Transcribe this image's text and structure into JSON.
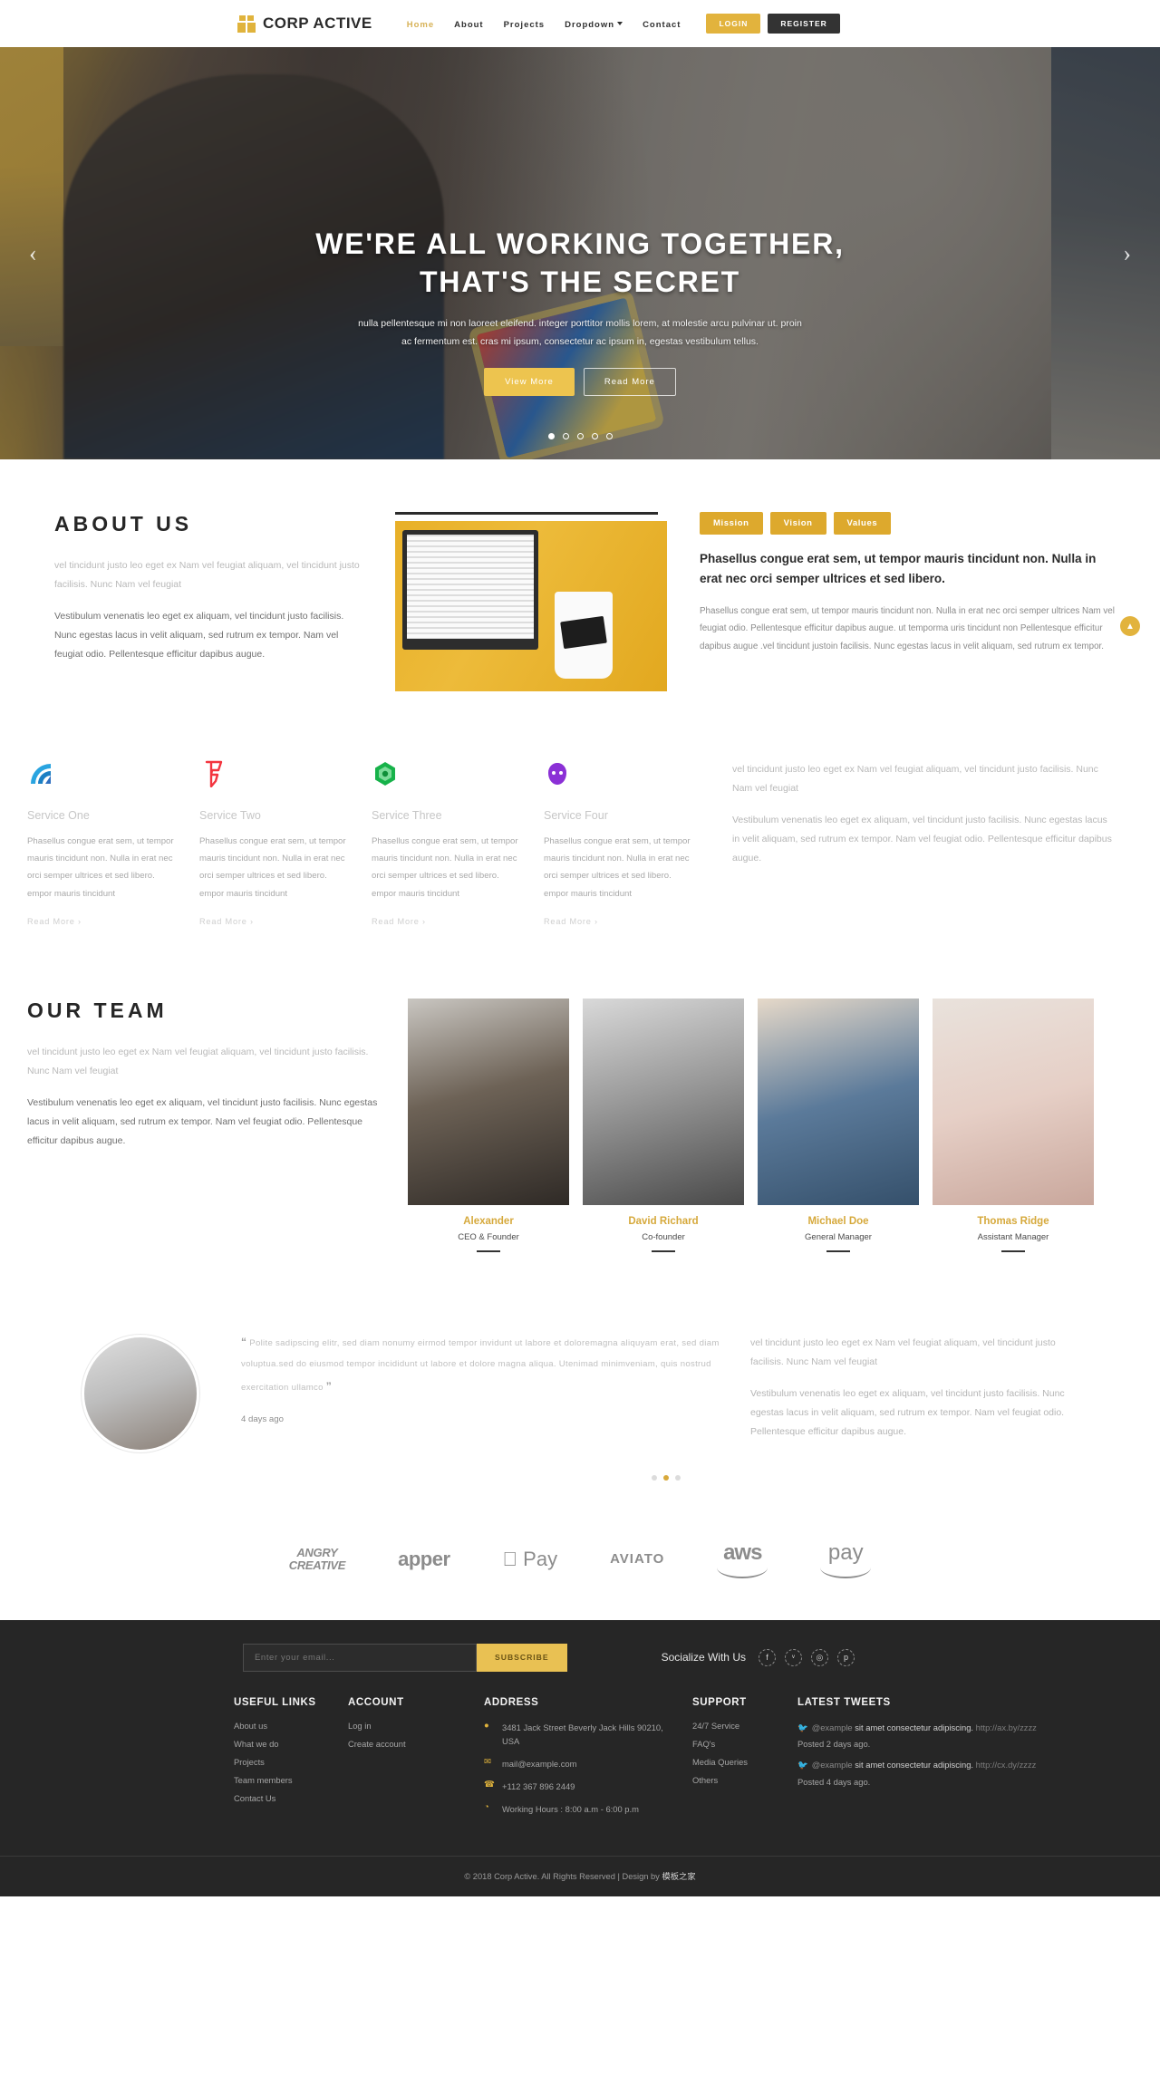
{
  "nav": {
    "brand": "CORP ACTIVE",
    "links": [
      {
        "label": "Home",
        "active": true
      },
      {
        "label": "About",
        "active": false
      },
      {
        "label": "Projects",
        "active": false
      },
      {
        "label": "Dropdown",
        "active": false,
        "caret": true
      },
      {
        "label": "Contact",
        "active": false
      }
    ],
    "login_label": "LOGIN",
    "register_label": "REGISTER",
    "accent": "#e0b33c"
  },
  "hero": {
    "title_line1": "WE'RE ALL WORKING TOGETHER,",
    "title_line2": "THAT'S THE SECRET",
    "subtitle_line1": "nulla pellentesque mi non laoreet eleifend. integer porttitor mollis lorem, at molestie arcu pulvinar ut. proin",
    "subtitle_line2": "ac fermentum est. cras mi ipsum, consectetur ac ipsum in, egestas vestibulum tellus.",
    "btn_primary": "View More",
    "btn_secondary": "Read More",
    "arrow_left": "‹",
    "arrow_right": "›",
    "slide_count": 5,
    "active_slide": 1
  },
  "about": {
    "title": "ABOUT US",
    "muted_paragraph": "vel tincidunt justo leo eget ex Nam vel feugiat aliquam, vel tincidunt justo facilisis. Nunc Nam vel feugiat",
    "paragraph": "Vestibulum venenatis leo eget ex aliquam, vel tincidunt justo facilisis. Nunc egestas lacus in velit aliquam, sed rutrum ex tempor. Nam vel feugiat odio. Pellentesque efficitur dapibus augue.",
    "tabs": [
      {
        "label": "Mission"
      },
      {
        "label": "Vision"
      },
      {
        "label": "Values"
      }
    ],
    "lead": "Phasellus congue erat sem, ut tempor mauris tincidunt non. Nulla in erat nec orci semper ultrices et sed libero.",
    "tab_body": "Phasellus congue erat sem, ut tempor mauris tincidunt non. Nulla in erat nec orci semper ultrices Nam vel feugiat odio. Pellentesque efficitur dapibus augue. ut temporma uris tincidunt non Pellentesque efficitur dapibus augue .vel tincidunt justoin facilisis. Nunc egestas lacus in velit aliquam, sed rutrum ex tempor."
  },
  "scroll_top_icon": "▲",
  "services": {
    "items": [
      {
        "icon": "wifi-waves-icon",
        "name": "Service One",
        "text": "Phasellus congue erat sem, ut tempor mauris tincidunt non. Nulla in erat nec orci semper ultrices et sed libero. empor mauris tincidunt",
        "more": "Read More ›"
      },
      {
        "icon": "foursquare-flag-icon",
        "name": "Service Two",
        "text": "Phasellus congue erat sem, ut tempor mauris tincidunt non. Nulla in erat nec orci semper ultrices et sed libero. empor mauris tincidunt",
        "more": "Read More ›"
      },
      {
        "icon": "green-hexagon-icon",
        "name": "Service Three",
        "text": "Phasellus congue erat sem, ut tempor mauris tincidunt non. Nulla in erat nec orci semper ultrices et sed libero. empor mauris tincidunt",
        "more": "Read More ›"
      },
      {
        "icon": "purple-blob-icon",
        "name": "Service Four",
        "text": "Phasellus congue erat sem, ut tempor mauris tincidunt non. Nulla in erat nec orci semper ultrices et sed libero. empor mauris tincidunt",
        "more": "Read More ›"
      }
    ],
    "aside_muted": "vel tincidunt justo leo eget ex Nam vel feugiat aliquam, vel tincidunt justo facilisis. Nunc Nam vel feugiat",
    "aside_text": "Vestibulum venenatis leo eget ex aliquam, vel tincidunt justo facilisis. Nunc egestas lacus in velit aliquam, sed rutrum ex tempor. Nam vel feugiat odio. Pellentesque efficitur dapibus augue."
  },
  "team": {
    "title": "OUR TEAM",
    "muted_paragraph": "vel tincidunt justo leo eget ex Nam vel feugiat aliquam, vel tincidunt justo facilisis. Nunc Nam vel feugiat",
    "paragraph": "Vestibulum venenatis leo eget ex aliquam, vel tincidunt justo facilisis. Nunc egestas lacus in velit aliquam, sed rutrum ex tempor. Nam vel feugiat odio. Pellentesque efficitur dapibus augue.",
    "members": [
      {
        "name": "Alexander",
        "role": "CEO & Founder"
      },
      {
        "name": "David Richard",
        "role": "Co-founder"
      },
      {
        "name": "Michael Doe",
        "role": "General Manager"
      },
      {
        "name": "Thomas Ridge",
        "role": "Assistant Manager"
      }
    ]
  },
  "testimonial": {
    "quote_open": "“",
    "quote_close": "”",
    "quote": "Polite sadipscing elitr, sed diam nonumy eirmod tempor invidunt ut labore et doloremagna aliquyam erat, sed diam voluptua.sed do eiusmod tempor incididunt ut labore et dolore magna aliqua. Utenimad minimveniam, quis nostrud exercitation ullamco",
    "ago": "4 days ago",
    "aside_muted": "vel tincidunt justo leo eget ex Nam vel feugiat aliquam, vel tincidunt justo facilisis. Nunc Nam vel feugiat",
    "aside_text": "Vestibulum venenatis leo eget ex aliquam, vel tincidunt justo facilisis. Nunc egestas lacus in velit aliquam, sed rutrum ex tempor. Nam vel feugiat odio. Pellentesque efficitur dapibus augue.",
    "dot_count": 3,
    "active_dot": 2
  },
  "brands": [
    {
      "name": "ANGRY CREATIVE",
      "line1": "ANGRY",
      "line2": "CREATIVE"
    },
    {
      "name": "apper",
      "text": "apper"
    },
    {
      "name": "Apple Pay",
      "text": " Pay"
    },
    {
      "name": "AVIATO",
      "text": "AVIATO"
    },
    {
      "name": "aws",
      "text": "aws"
    },
    {
      "name": "amazon pay",
      "text": "pay"
    }
  ],
  "footer": {
    "subscribe_placeholder": "Enter your email...",
    "subscribe_value": "",
    "subscribe_button": "SUBSCRIBE",
    "social_label": "Socialize With Us",
    "socials": [
      {
        "icon": "facebook-icon",
        "glyph": "f"
      },
      {
        "icon": "twitter-icon",
        "glyph": "ᵛ"
      },
      {
        "icon": "instagram-icon",
        "glyph": "◎"
      },
      {
        "icon": "pinterest-icon",
        "glyph": "p"
      }
    ],
    "columns": {
      "useful_links": {
        "heading": "USEFUL LINKS",
        "items": [
          "About us",
          "What we do",
          "Projects",
          "Team members",
          "Contact Us"
        ]
      },
      "account": {
        "heading": "ACCOUNT",
        "items": [
          "Log in",
          "Create account"
        ]
      },
      "address": {
        "heading": "ADDRESS",
        "items": [
          {
            "icon": "location-pin-icon",
            "glyph": "●",
            "text": "3481 Jack Street Beverly Jack Hills 90210, USA"
          },
          {
            "icon": "envelope-icon",
            "glyph": "✉",
            "text": "mail@example.com"
          },
          {
            "icon": "phone-icon",
            "glyph": "☎",
            "text": "+112 367 896 2449"
          },
          {
            "icon": "clock-icon",
            "glyph": "◔",
            "text": "Working Hours : 8:00 a.m - 6:00 p.m"
          }
        ]
      },
      "support": {
        "heading": "SUPPORT",
        "items": [
          "24/7 Service",
          "FAQ's",
          "Media Queries",
          "Others"
        ]
      },
      "tweets": {
        "heading": "LATEST TWEETS",
        "items": [
          {
            "handle": "@example",
            "text": " sit amet consectetur adipiscing. ",
            "link": "http://ax.by/zzzz",
            "ago": "Posted 2 days ago."
          },
          {
            "handle": "@example",
            "text": " sit amet consectetur adipiscing. ",
            "link": "http://cx.dy/zzzz",
            "ago": "Posted 4 days ago."
          }
        ]
      }
    },
    "copyright_prefix": "© 2018 Corp Active. All Rights Reserved | Design by ",
    "copyright_brand": "模板之家"
  }
}
